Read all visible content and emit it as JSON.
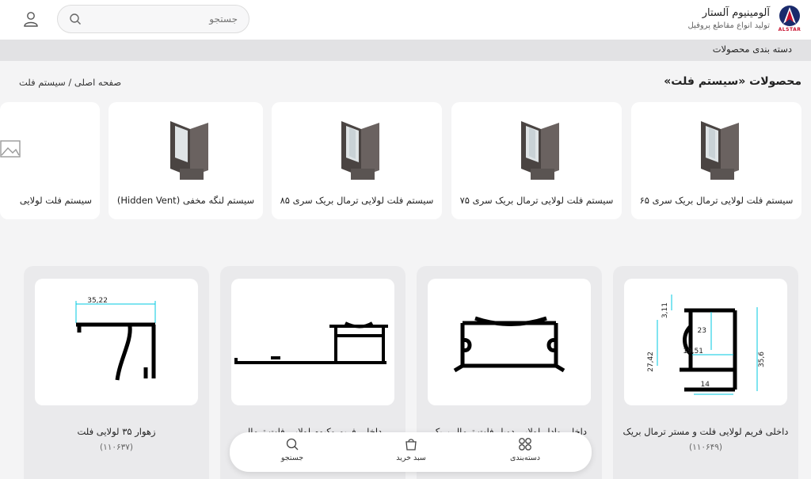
{
  "header": {
    "brand_name": "آلومینیوم آلستار",
    "brand_sub": "تولید انواع مقاطع پروفیل",
    "logo_text": "ALSTAR",
    "search_placeholder": "جستجو"
  },
  "category_bar": {
    "label": "دسته بندی محصولات"
  },
  "page": {
    "title": "محصولات «سیستم فلت»",
    "breadcrumb": "صفحه اصلی / سیستم فلت"
  },
  "categories": [
    {
      "label": "سیستم فلت لولایی ترمال بریک سری ۶۵"
    },
    {
      "label": "سیستم فلت لولایی ترمال بریک سری ۷۵"
    },
    {
      "label": "سیستم فلت لولایی ترمال بریک سری ۸۵"
    },
    {
      "label": "سیستم لنگه مخفی (Hidden Vent)"
    },
    {
      "label": "سیستم فلت لولایی"
    }
  ],
  "products": [
    {
      "name": "داخلی فریم لولایی فلت و مستر ترمال بریک",
      "code": "(۱۱۰۶۴۹)"
    },
    {
      "name": "داخلی وادار لولایی دوبل فلت ترمال بریک",
      "code": ""
    },
    {
      "name": "داخلی فریم وکیوم لولایی فلت ترمال",
      "code": ""
    },
    {
      "name": "زهوار ۳۵ لولایی فلت",
      "code": "(۱۱۰۶۳۷)"
    }
  ],
  "drawing_labels": {
    "p1": [
      "3,11",
      "27,42",
      "23",
      "19,51",
      "35,6",
      "14"
    ],
    "p4": [
      "35,22"
    ]
  },
  "bottom_nav": {
    "categories": "دسته‌بندی",
    "cart": "سبد خرید",
    "search": "جستجو"
  },
  "colors": {
    "accent": "#1a2a6c",
    "logo_red": "#c8102e",
    "dimension": "#00c8e0",
    "profile": "#3a3634"
  }
}
